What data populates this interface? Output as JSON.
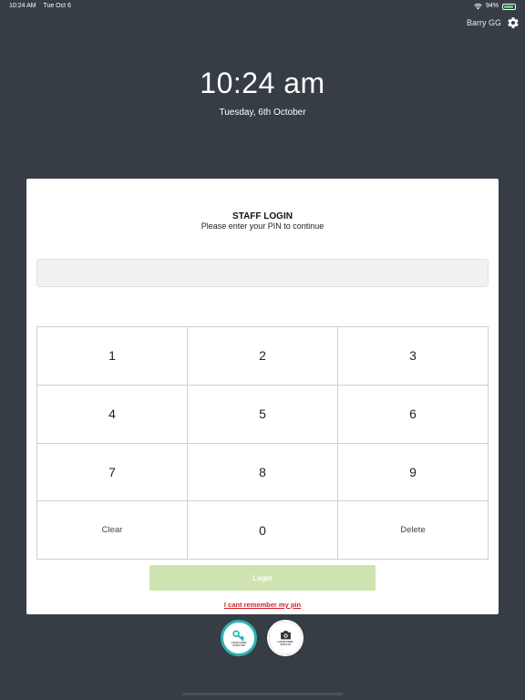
{
  "status_bar": {
    "time": "10:24 AM",
    "date": "Tue Oct 6",
    "battery": "94%",
    "battery_level": 0.94,
    "icons": [
      "wifi-icon",
      "battery-icon"
    ]
  },
  "user": {
    "name": "Barry GG",
    "settings_icon": "gear-icon"
  },
  "clock": {
    "time": "10:24 am",
    "date": "Tuesday, 6th October"
  },
  "login": {
    "title": "STAFF LOGIN",
    "subtitle": "Please enter your PIN to continue",
    "pin_value": ""
  },
  "keypad": {
    "keys": [
      "1",
      "2",
      "3",
      "4",
      "5",
      "6",
      "7",
      "8",
      "9",
      "Clear",
      "0",
      "Delete"
    ]
  },
  "actions": {
    "login_label": "Login",
    "forgot_label": "I cant remember my pin"
  },
  "modes": {
    "pin_label": "LOGIN USING\nSTAFF PIN",
    "photo_label": "LOGIN USING\nSTAFF ID"
  },
  "colors": {
    "background": "#363d45",
    "accent": "#2bb3b0",
    "login_button": "#cfe3b1",
    "link": "#d2232a"
  }
}
